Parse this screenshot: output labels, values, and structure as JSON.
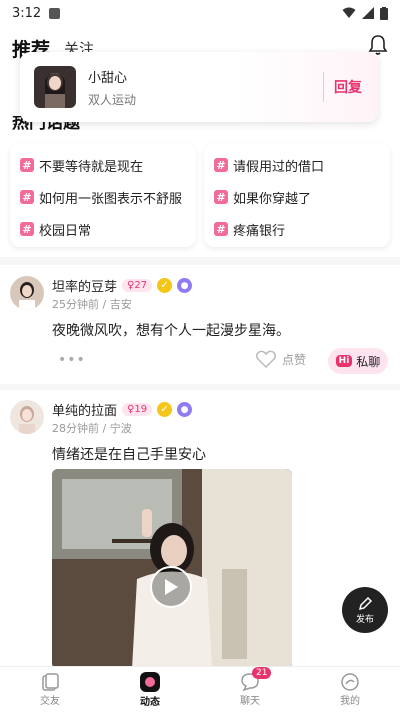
{
  "status_bar": {
    "time": "3:12"
  },
  "header": {
    "tab_recommend": "推荐",
    "tab_follow": "关注"
  },
  "toast": {
    "name": "小甜心",
    "message": "双人运动",
    "reply_label": "回复"
  },
  "topics": {
    "title": "热门话题",
    "hash_symbol": "#",
    "left": [
      "不要等待就是现在",
      "如何用一张图表示不舒服",
      "校园日常"
    ],
    "right": [
      "请假用过的借口",
      "如果你穿越了",
      "疼痛银行"
    ]
  },
  "posts": [
    {
      "username": "坦率的豆芽",
      "age": "27",
      "meta": "25分钟前 / 吉安",
      "content": "夜晚微风吹，想有个人一起漫步星海。",
      "more": "•••",
      "like_label": "点赞",
      "chat_hi": "Hi",
      "chat_label": "私聊"
    },
    {
      "username": "单纯的拉面",
      "age": "19",
      "meta": "28分钟前 / 宁波",
      "content": "情绪还是在自己手里安心"
    }
  ],
  "fab": {
    "label": "发布"
  },
  "nav": {
    "items": [
      "交友",
      "动态",
      "聊天",
      "我的"
    ],
    "chat_badge": "21"
  },
  "colors": {
    "accent": "#e8336d",
    "hash_bg": "#f36a9b",
    "badge_bg": "#fde4ef"
  }
}
